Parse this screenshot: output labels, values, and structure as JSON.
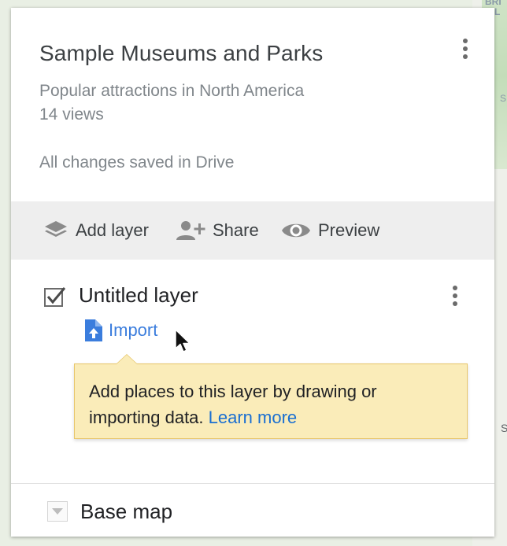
{
  "map": {
    "labels": [
      "BRI",
      "CLL",
      "S",
      "S"
    ]
  },
  "header": {
    "title": "Sample Museums and Parks",
    "description": "Popular attractions in North America",
    "views": "14 views",
    "save_status": "All changes saved in Drive",
    "menu_icon": "more-vert-icon"
  },
  "toolbar": {
    "add_layer_label": "Add layer",
    "add_layer_icon": "layers-icon",
    "share_label": "Share",
    "share_icon": "person-add-icon",
    "preview_label": "Preview",
    "preview_icon": "eye-icon"
  },
  "layer": {
    "title": "Untitled layer",
    "checked": true,
    "import_label": "Import",
    "import_icon": "file-upload-icon"
  },
  "tooltip": {
    "text": "Add places to this layer by drawing or importing data.",
    "link_label": "Learn more"
  },
  "base_map": {
    "label": "Base map"
  },
  "colors": {
    "accent_blue": "#3b7ddd",
    "link_blue": "#1a6fd1",
    "tooltip_bg": "#faecb9",
    "toolbar_bg": "#eeeeee"
  }
}
